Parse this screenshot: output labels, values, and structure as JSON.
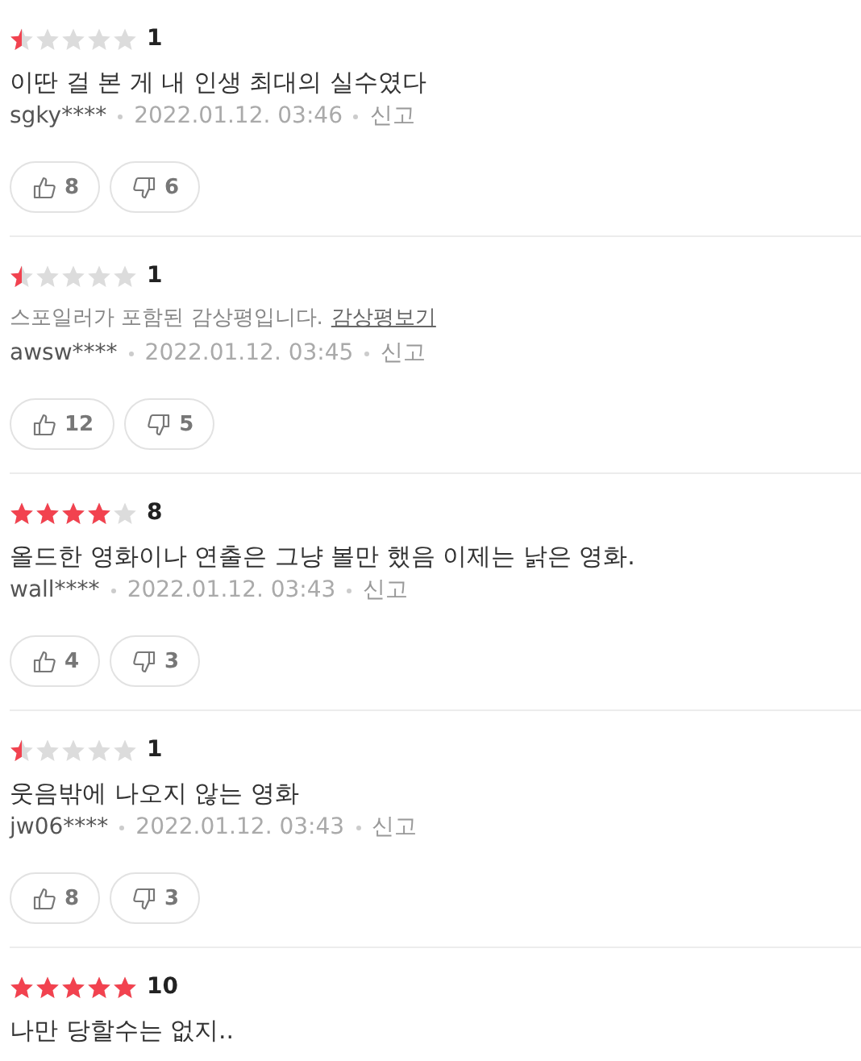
{
  "reviews": [
    {
      "kind": "text",
      "stars": 0.5,
      "score": "1",
      "text": "이딴 걸 본 게 내 인생 최대의 실수였다",
      "user": "sgky****",
      "date": "2022.01.12. 03:46",
      "report": "신고",
      "likes": "8",
      "dislikes": "6"
    },
    {
      "kind": "spoiler",
      "stars": 0.5,
      "score": "1",
      "text": "스포일러가 포함된 감상평입니다.",
      "link": "감상평보기",
      "user": "awsw****",
      "date": "2022.01.12. 03:45",
      "report": "신고",
      "likes": "12",
      "dislikes": "5"
    },
    {
      "kind": "text",
      "stars": 4,
      "score": "8",
      "text": "올드한 영화이나 연출은 그냥 볼만 했음 이제는 낡은 영화.",
      "user": "wall****",
      "date": "2022.01.12. 03:43",
      "report": "신고",
      "likes": "4",
      "dislikes": "3"
    },
    {
      "kind": "text",
      "stars": 0.5,
      "score": "1",
      "text": "웃음밖에 나오지 않는 영화",
      "user": "jw06****",
      "date": "2022.01.12. 03:43",
      "report": "신고",
      "likes": "8",
      "dislikes": "3"
    },
    {
      "kind": "text",
      "stars": 5,
      "score": "10",
      "text": "나만 당할수는 없지.."
    }
  ]
}
